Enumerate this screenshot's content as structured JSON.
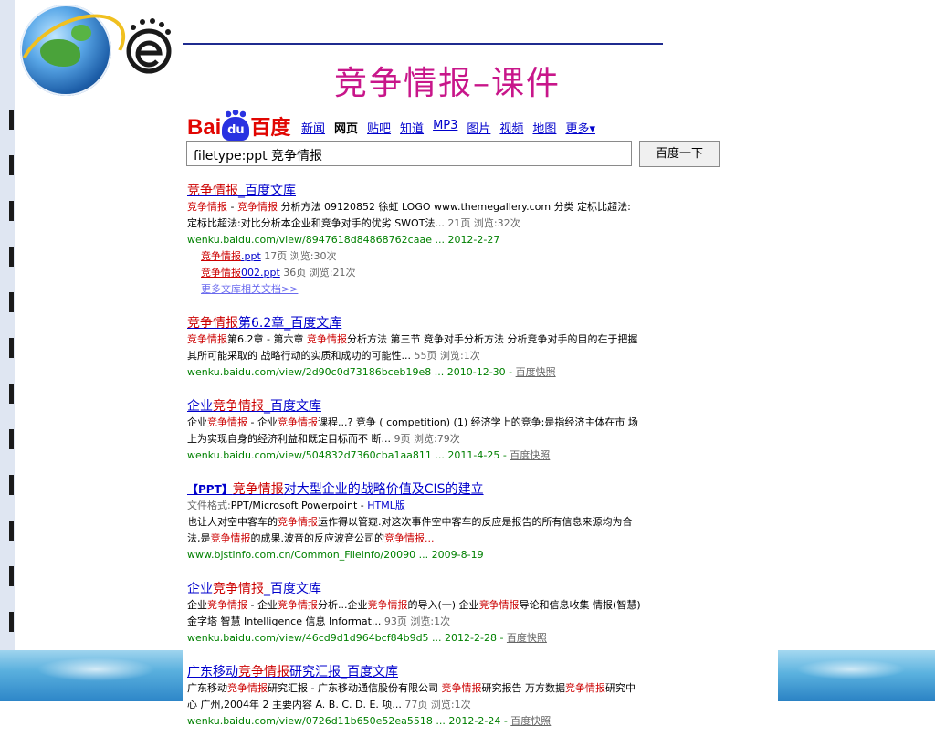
{
  "slide_title": "竞争情报–课件",
  "baidu": {
    "logo_bai": "Bai",
    "logo_du": "du",
    "logo_cn": "百度",
    "nav": [
      "新闻",
      "网页",
      "贴吧",
      "知道",
      "MP3",
      "图片",
      "视频",
      "地图",
      "更多▾"
    ],
    "nav_current": "网页",
    "query": "filetype:ppt 竞争情报",
    "search_button": "百度一下"
  },
  "results": {
    "r1": {
      "t_hl": "竞争情报",
      "t_rest": "_百度文库",
      "d_hl1": "竞争情报",
      "d_sep": " - ",
      "d_hl2": "竞争情报",
      "d_rest1": " 分析方法 09120852 徐虹 LOGO www.themegallery.com 分类 定标比超法: 定标比超法:对比分析本企业和竞争对手的优劣 SWOT法...",
      "d_meta": " 21页 浏览:32次",
      "url": "wenku.baidu.com/view/8947618d84868762caae ... 2012-2-27",
      "sub1_l": "竞争情报",
      "sub1_ext": ".ppt",
      "sub1_meta": " 17页 浏览:30次",
      "sub2_l": "竞争情报",
      "sub2_ext": "002.ppt",
      "sub2_meta": " 36页 浏览:21次",
      "more": "更多文库相关文档>>"
    },
    "r2": {
      "t_hl": "竞争情报",
      "t_rest": "第6.2章_百度文库",
      "d_hl1": "竞争情报",
      "d_rest1": "第6.2章 - 第六章 ",
      "d_hl2": "竞争情报",
      "d_rest2": "分析方法 第三节 竞争对手分析方法 分析竞争对手的目的在于把握其所可能采取的 战略行动的实质和成功的可能性...",
      "d_meta": " 55页 浏览:1次",
      "url": "wenku.baidu.com/view/2d90c0d73186bceb19e8 ... 2010-12-30 - ",
      "kz": "百度快照"
    },
    "r3": {
      "t_pre": "企业",
      "t_hl": "竞争情报",
      "t_rest": "_百度文库",
      "d_pre": "企业",
      "d_hl1": "竞争情报",
      "d_mid": " - 企业",
      "d_hl2": "竞争情报",
      "d_rest": "课程...? 竞争 ( competition) (1) 经济学上的竞争:是指经济主体在市 场上为实现自身的经济利益和既定目标而不 断...",
      "d_meta": " 9页 浏览:79次",
      "url": "wenku.baidu.com/view/504832d7360cba1aa811 ... 2011-4-25 - ",
      "kz": "百度快照"
    },
    "r4": {
      "tag": "【PPT】",
      "t_hl": "竞争情报",
      "t_rest": "对大型企业的战略价值及CIS的建立",
      "fmt_label": "文件格式:",
      "fmt_val": "PPT/Microsoft Powerpoint - ",
      "fmt_link": "HTML版",
      "d_pre": "也让人对空中客车的",
      "d_hl1": "竞争情报",
      "d_mid": "运作得以管窥.对这次事件空中客车的反应是报告的所有信息来源均为合法,是",
      "d_hl2": "竞争情报",
      "d_mid2": "的成果.波音的反应波音公司的",
      "d_hl3": "竞争情报",
      "d_end": "...",
      "url": "www.bjstinfo.com.cn/Common_FileInfo/20090 ... 2009-8-19"
    },
    "r5": {
      "t_pre": "企业",
      "t_hl": "竞争情报",
      "t_rest": "_百度文库",
      "d_pre": "企业",
      "d_hl1": "竞争情报",
      "d_mid": " - 企业",
      "d_hl2": "竞争情报",
      "d_mid2": "分析...企业",
      "d_hl3": "竞争情报",
      "d_mid3": "的导入(一) 企业",
      "d_hl4": "竞争情报",
      "d_rest": "导论和信息收集 情报(智慧)金字塔 智慧 Intelligence 信息 Informat...",
      "d_meta": " 93页 浏览:1次",
      "url": "wenku.baidu.com/view/46cd9d1d964bcf84b9d5 ... 2012-2-28 - ",
      "kz": "百度快照"
    },
    "r6": {
      "t_pre": "广东移动",
      "t_hl": "竞争情报",
      "t_rest": "研究汇报_百度文库",
      "d_pre": "广东移动",
      "d_hl1": "竞争情报",
      "d_mid": "研究汇报 - 广东移动通信股份有限公司 ",
      "d_hl2": "竞争情报",
      "d_mid2": "研究报告 万方数据",
      "d_hl3": "竞争情报",
      "d_rest": "研究中心 广州,2004年 2 主要内容 A. B. C. D. E. 项...",
      "d_meta": " 77页 浏览:1次",
      "url": "wenku.baidu.com/view/0726d11b650e52ea5518 ... 2012-2-24 - ",
      "kz": "百度快照"
    }
  },
  "colors": {
    "title": "#c8168a",
    "link": "#0000cc",
    "highlight": "#cc0000",
    "url": "#008000",
    "rule": "#1f2b8f"
  },
  "icons": [
    "globe-icon",
    "e-logo-icon",
    "baidu-paw-icon"
  ]
}
